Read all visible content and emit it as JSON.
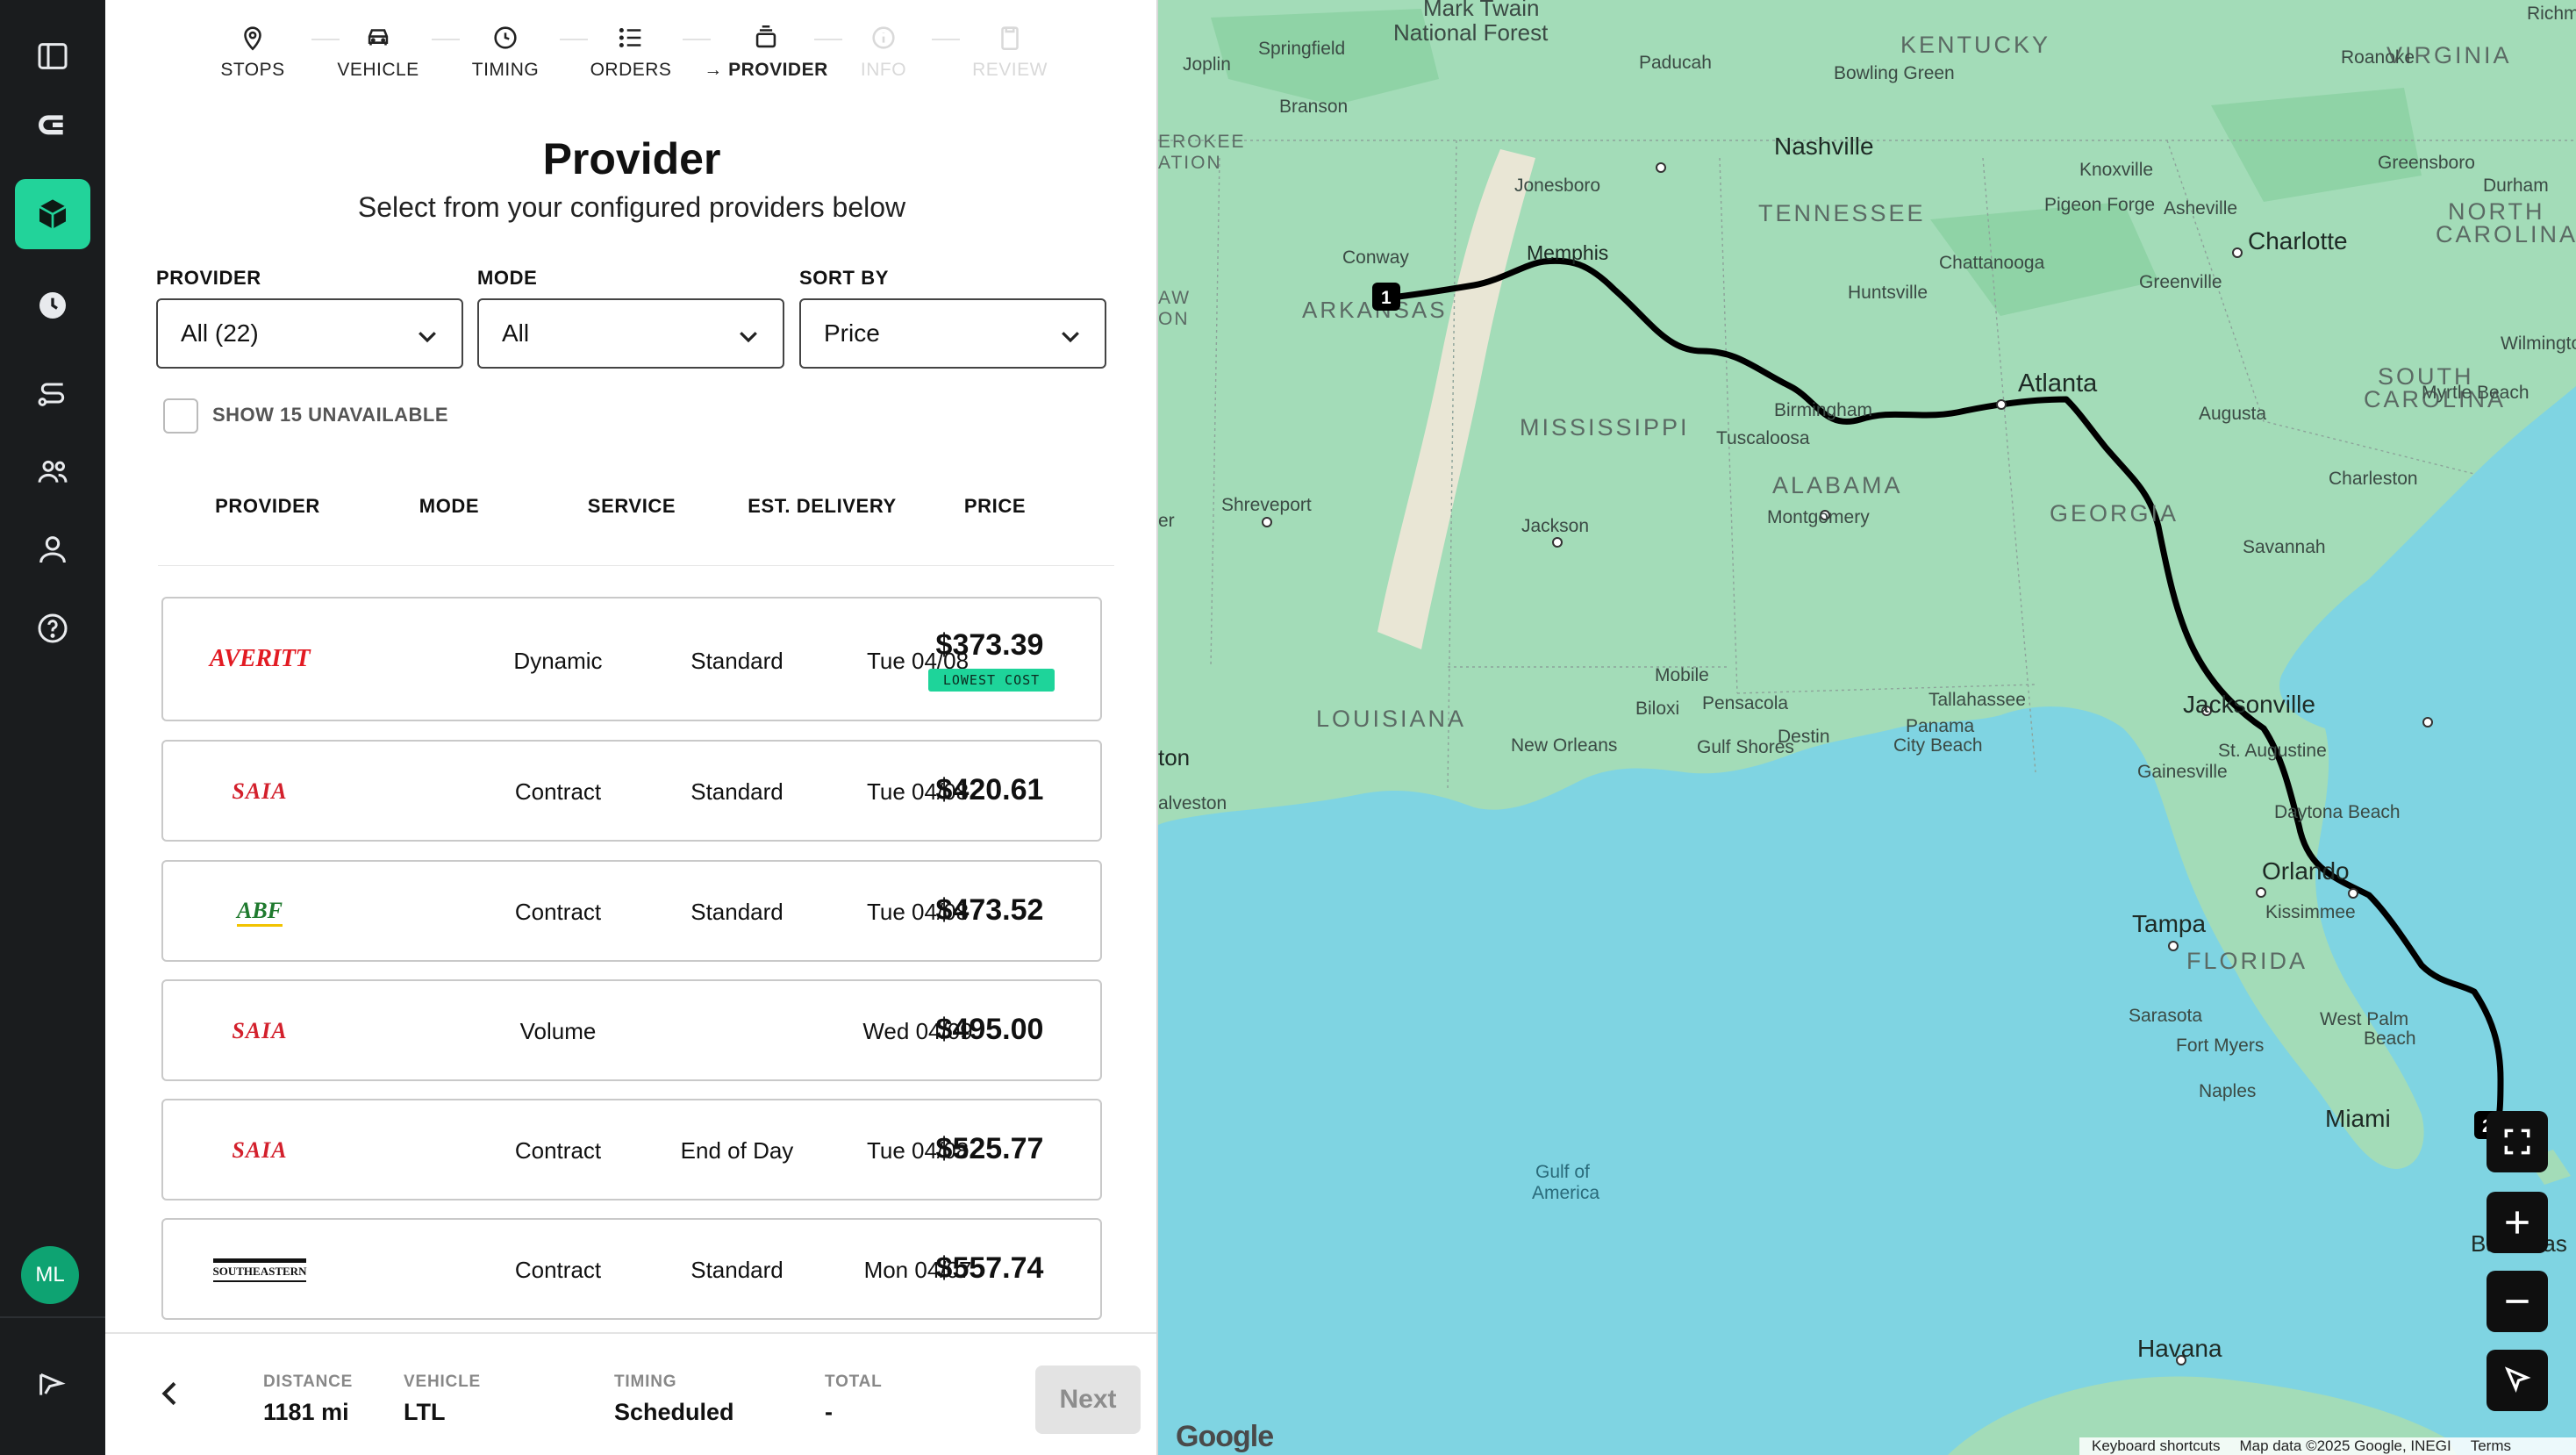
{
  "rail": {
    "avatar_initials": "ML",
    "accent": "#22d39a"
  },
  "steps": [
    {
      "label": "STOPS",
      "icon": "pin-icon",
      "state": "done"
    },
    {
      "label": "VEHICLE",
      "icon": "car-icon",
      "state": "done"
    },
    {
      "label": "TIMING",
      "icon": "clock-icon",
      "state": "done"
    },
    {
      "label": "ORDERS",
      "icon": "list-icon",
      "state": "done"
    },
    {
      "label": "→ PROVIDER",
      "icon": "stack-icon",
      "state": "current"
    },
    {
      "label": "INFO",
      "icon": "info-icon",
      "state": "disabled"
    },
    {
      "label": "REVIEW",
      "icon": "clipboard-icon",
      "state": "disabled"
    }
  ],
  "header": {
    "title": "Provider",
    "subtitle": "Select from your configured providers below"
  },
  "filters": {
    "provider": {
      "label": "PROVIDER",
      "value": "All (22)"
    },
    "mode": {
      "label": "MODE",
      "value": "All"
    },
    "sort": {
      "label": "SORT BY",
      "value": "Price"
    },
    "unavailable_label": "SHOW 15 UNAVAILABLE"
  },
  "table": {
    "columns": [
      "PROVIDER",
      "MODE",
      "SERVICE",
      "EST. DELIVERY",
      "PRICE"
    ],
    "rows": [
      {
        "logo": "AVERITT",
        "mode": "Dynamic",
        "service": "Standard",
        "delivery": "Tue 04/08",
        "price": "$373.39",
        "badge": "LOWEST COST"
      },
      {
        "logo": "SAIA",
        "mode": "Contract",
        "service": "Standard",
        "delivery": "Tue 04/08",
        "price": "$420.61"
      },
      {
        "logo": "ABF",
        "mode": "Contract",
        "service": "Standard",
        "delivery": "Tue 04/08",
        "price": "$473.52"
      },
      {
        "logo": "SAIA",
        "mode": "Volume",
        "service": "",
        "delivery": "Wed 04/09",
        "price": "$495.00"
      },
      {
        "logo": "SAIA",
        "mode": "Contract",
        "service": "End of Day",
        "delivery": "Tue 04/08",
        "price": "$525.77"
      },
      {
        "logo": "SOUTHEASTERN",
        "mode": "Contract",
        "service": "Standard",
        "delivery": "Mon 04/07",
        "price": "$557.74"
      }
    ]
  },
  "footer": {
    "distance_label": "DISTANCE",
    "distance": "1181 mi",
    "vehicle_label": "VEHICLE",
    "vehicle": "LTL",
    "timing_label": "TIMING",
    "timing": "Scheduled",
    "total_label": "TOTAL",
    "total": "-",
    "next_label": "Next"
  },
  "map": {
    "labels": {
      "mark_twain": "Mark Twain",
      "national_forest": "National Forest",
      "kentucky": "KENTUCKY",
      "virginia": "VIRGINIA",
      "richmond": "Richm",
      "springfield": "Springfield",
      "joplin": "Joplin",
      "paducah": "Paducah",
      "bowling_green": "Bowling Green",
      "roanoke": "Roanoke",
      "branson": "Branson",
      "erokee": "EROKEE",
      "ation": "ATION",
      "nashville": "Nashville",
      "knoxville": "Knoxville",
      "greensboro": "Greensboro",
      "durham": "Durham",
      "jonesboro": "Jonesboro",
      "tennessee": "TENNESSEE",
      "pigeon_forge": "Pigeon Forge",
      "asheville": "Asheville",
      "north": "NORTH",
      "carolina": "CAROLINA",
      "conway": "Conway",
      "memphis": "Memphis",
      "charlotte": "Charlotte",
      "chattanooga": "Chattanooga",
      "aw": "AW",
      "on": "ON",
      "arkansas": "ARKANSAS",
      "huntsville": "Huntsville",
      "greenville": "Greenville",
      "wilmington": "Wilmingto",
      "south": "SOUTH",
      "south_carolina": "CAROLINA",
      "atlanta": "Atlanta",
      "mississippi": "MISSISSIPPI",
      "birmingham": "Birmingham",
      "augusta": "Augusta",
      "myrtle_beach": "Myrtle Beach",
      "tuscaloosa": "Tuscaloosa",
      "alabama": "ALABAMA",
      "er": "er",
      "shreveport": "Shreveport",
      "charleston": "Charleston",
      "montgomery": "Montgomery",
      "georgia": "GEORGIA",
      "jackson": "Jackson",
      "savannah": "Savannah",
      "louisiana": "LOUISIANA",
      "mobile": "Mobile",
      "tallahassee": "Tallahassee",
      "biloxi": "Biloxi",
      "pensacola": "Pensacola",
      "jacksonville": "Jacksonville",
      "panama": "Panama",
      "city_beach": "City Beach",
      "st_augustine": "St. Augustine",
      "new_orleans": "New Orleans",
      "destin": "Destin",
      "gulf_shores": "Gulf Shores",
      "ton": "ton",
      "gainesville": "Gainesville",
      "alveston": "alveston",
      "daytona": "Daytona Beach",
      "orlando": "Orlando",
      "kissimmee": "Kissimmee",
      "tampa": "Tampa",
      "florida": "FLORIDA",
      "west_palm": "West Palm",
      "beach": "Beach",
      "sarasota": "Sarasota",
      "fort_myers": "Fort Myers",
      "naples": "Naples",
      "miami": "Miami",
      "gulf": "Gulf of",
      "america": "America",
      "bahamas": "Bahamas",
      "havana": "Havana"
    },
    "marker_1": "1",
    "marker_2": "2",
    "attribution": [
      "Keyboard shortcuts",
      "Map data ©2025 Google, INEGI",
      "Terms"
    ],
    "google": "Google",
    "land_color": "#9fdcb7",
    "water_color": "#7fd4e2",
    "route_color": "#000000"
  }
}
